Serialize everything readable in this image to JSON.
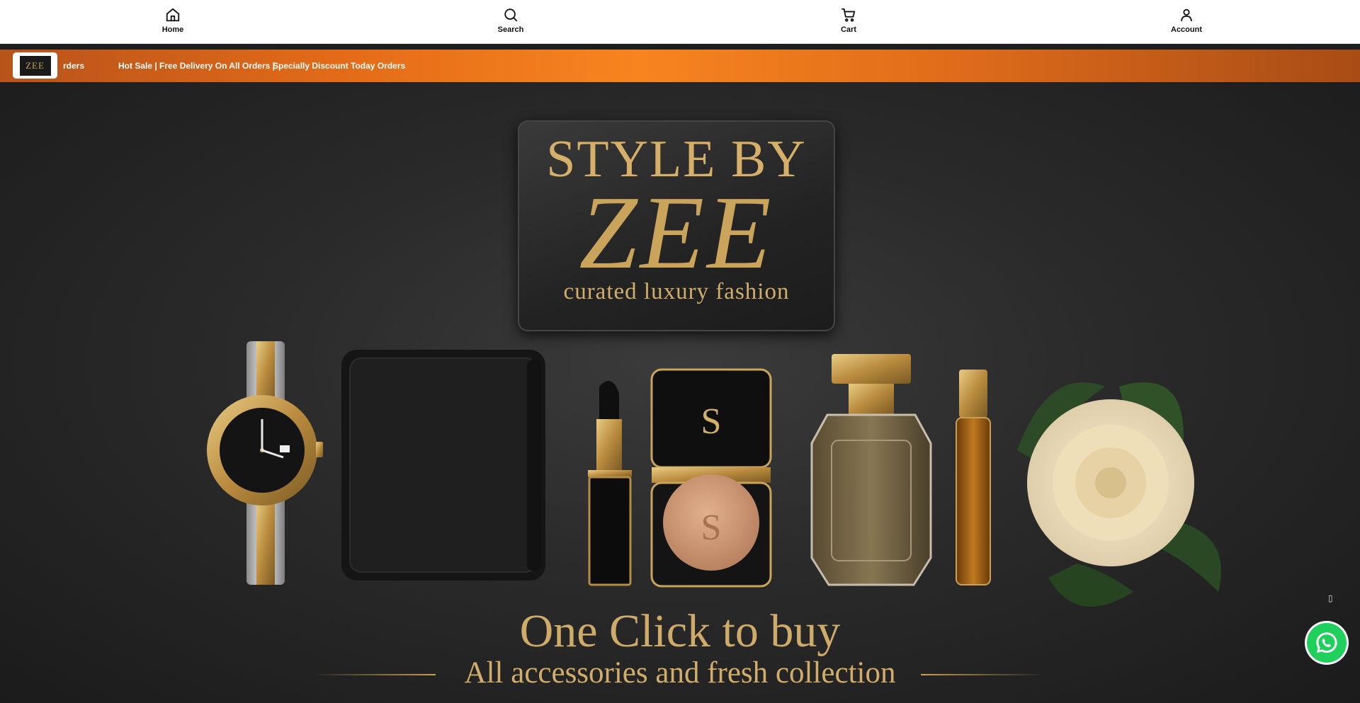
{
  "nav": {
    "items": [
      {
        "label": "Home",
        "icon": "home-icon"
      },
      {
        "label": "Search",
        "icon": "search-icon"
      },
      {
        "label": "Cart",
        "icon": "cart-icon"
      },
      {
        "label": "Account",
        "icon": "account-icon"
      }
    ]
  },
  "promo": {
    "logo_text": "ZEE",
    "text_1": "rders",
    "text_2": "Hot Sale | Free Delivery On All Orders |",
    "text_3": "Specially Discount Today Orders",
    "colors": {
      "start": "#b8531a",
      "mid": "#f7841f",
      "end": "#a84c16"
    }
  },
  "hero": {
    "plaque_line_1": "STYLE BY",
    "plaque_line_2": "ZEE",
    "plaque_line_3": "curated luxury fashion",
    "tagline_1": "One Click to buy",
    "tagline_2": "All accessories and fresh collection",
    "accent_color": "#caa45a"
  },
  "floating": {
    "scroll_glyph": "▯",
    "whatsapp_icon": "whatsapp-icon",
    "whatsapp_color": "#1fd05d"
  }
}
